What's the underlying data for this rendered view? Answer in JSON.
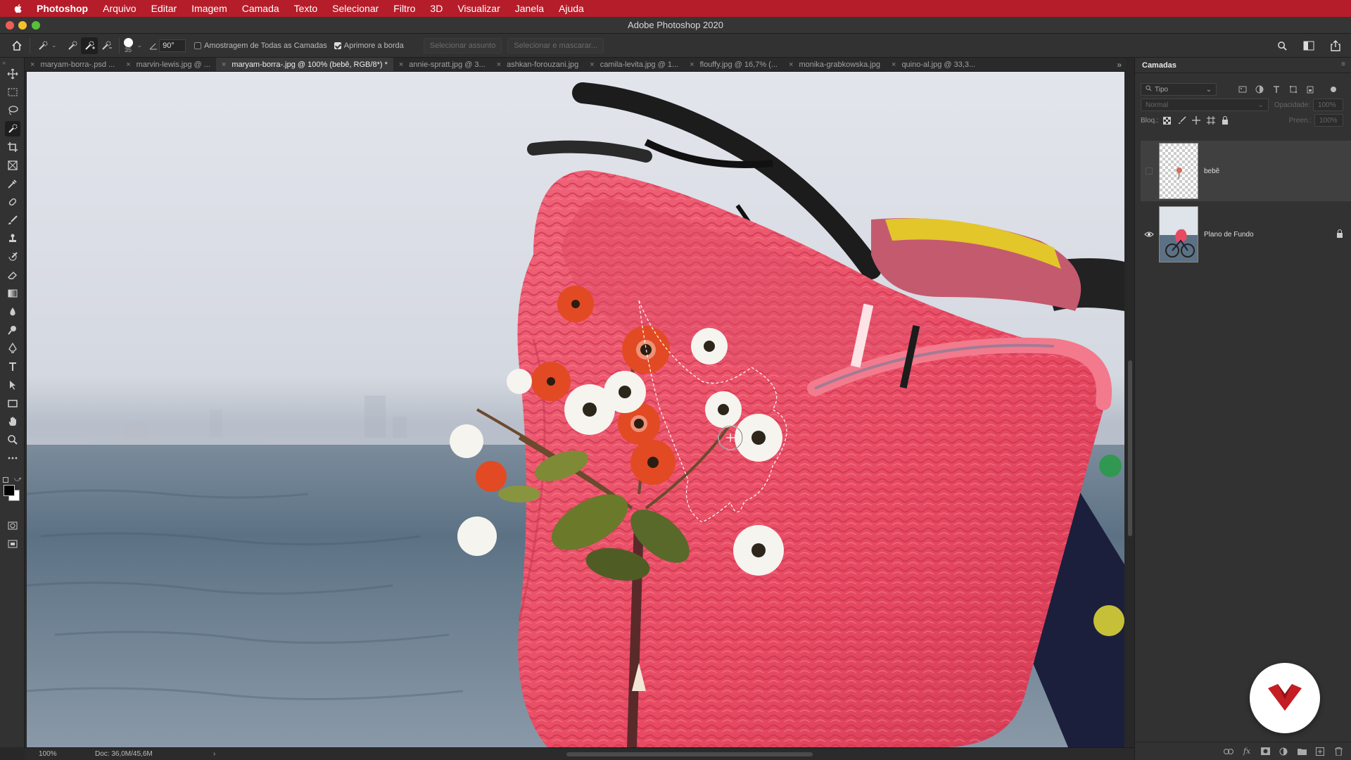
{
  "menubar": {
    "app": "Photoshop",
    "items": [
      "Arquivo",
      "Editar",
      "Imagem",
      "Camada",
      "Texto",
      "Selecionar",
      "Filtro",
      "3D",
      "Visualizar",
      "Janela",
      "Ajuda"
    ]
  },
  "window": {
    "title": "Adobe Photoshop 2020"
  },
  "options": {
    "brush_size": "35",
    "angle": "90°",
    "sample_all_layers": "Amostragem de Todas as Camadas",
    "enhance_edge": "Aprimore a borda",
    "select_subject": "Selecionar assunto",
    "select_and_mask": "Selecionar e mascarar..."
  },
  "tabs": [
    {
      "label": "maryam-borra-.psd ..."
    },
    {
      "label": "marvin-lewis.jpg @ ..."
    },
    {
      "label": "maryam-borra-.jpg @ 100% (bebê, RGB/8*) *"
    },
    {
      "label": "annie-spratt.jpg @ 3..."
    },
    {
      "label": "ashkan-forouzani.jpg"
    },
    {
      "label": "camila-levita.jpg @ 1..."
    },
    {
      "label": "flouffy.jpg @ 16,7% (..."
    },
    {
      "label": "monika-grabkowska.jpg"
    },
    {
      "label": "quino-al.jpg @ 33,3..."
    }
  ],
  "status": {
    "zoom": "100%",
    "doc": "Doc: 36,0M/45,6M",
    "arrow": "›"
  },
  "layers_panel": {
    "tab": "Camadas",
    "filter_kind": "Tipo",
    "blend_mode": "Normal",
    "opacity_label": "Opacidade:",
    "opacity_value": "100%",
    "lock_label": "Bloq.:",
    "fill_label": "Preen.:",
    "fill_value": "100%",
    "layers": [
      {
        "name": "bebê",
        "visible": false,
        "selected": true
      },
      {
        "name": "Plano de Fundo",
        "visible": true,
        "locked": true
      }
    ]
  },
  "colors": {
    "menubar": "#b51d2a",
    "basket": "#e8455f",
    "sea": "#51687a",
    "sky": "#dfe3ea",
    "badge_logo": "#c41e24"
  }
}
